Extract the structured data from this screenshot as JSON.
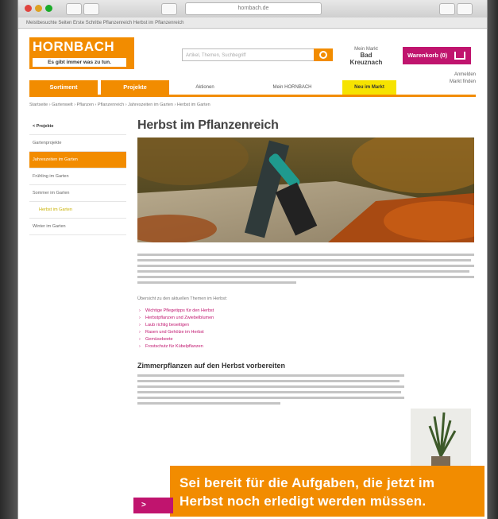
{
  "browser": {
    "url": "hornbach.de",
    "bookmarks": "Meistbesuchte Seiten   Erste Schritte   Pflanzenreich   Herbst im Pflanzenreich"
  },
  "header": {
    "logo_brand": "HORNBACH",
    "logo_slogan": "Es gibt immer was zu tun.",
    "search_placeholder": "Artikel, Themen, Suchbegriff",
    "store_label": "Mein Markt",
    "store_name": "Bad Kreuznach",
    "cart_label": "Warenkorb (0)",
    "util_links": [
      "Anmelden",
      "Markt finden"
    ]
  },
  "nav": {
    "tabs": [
      "Sortiment",
      "Projekte"
    ],
    "text_links": [
      "Aktionen",
      "Mein HORNBACH"
    ],
    "highlight": "Neu im Markt"
  },
  "breadcrumb": "Startseite › Gartenwelt › Pflanzen › Pflanzenreich › Jahreszeiten im Garten › Herbst im Garten",
  "sidebar": {
    "items": [
      {
        "label": "< Projekte",
        "type": "head"
      },
      {
        "label": "Gartenprojekte",
        "type": "normal"
      },
      {
        "label": "Jahreszeiten im Garten",
        "type": "active"
      },
      {
        "label": "Frühling im Garten",
        "type": "normal"
      },
      {
        "label": "Sommer im Garten",
        "type": "normal"
      },
      {
        "label": "Herbst im Garten",
        "type": "sub"
      },
      {
        "label": "Winter im Garten",
        "type": "normal"
      }
    ]
  },
  "main": {
    "title": "Herbst im Pflanzenreich",
    "intro": "Übersicht zu den aktuellen Themen im Herbst:",
    "links": [
      "Wichtige Pflegetipps für den Herbst",
      "Herbstpflanzen und Zwiebelblumen",
      "Laub richtig beseitigen",
      "Rasen und Gehölze im Herbst",
      "Gemüsebeete",
      "Frostschutz für Kübelpflanzen"
    ],
    "section_heading": "Zimmerpflanzen auf den Herbst vorbereiten"
  },
  "overlay": {
    "caption_line1": "Sei bereit für die Aufgaben, die jetzt im",
    "caption_line2": "Herbst noch erledigt werden müssen.",
    "button_label": "> "
  },
  "colors": {
    "brand_orange": "#f28c00",
    "accent_pink": "#c0146e",
    "highlight_yellow": "#f6e300"
  }
}
